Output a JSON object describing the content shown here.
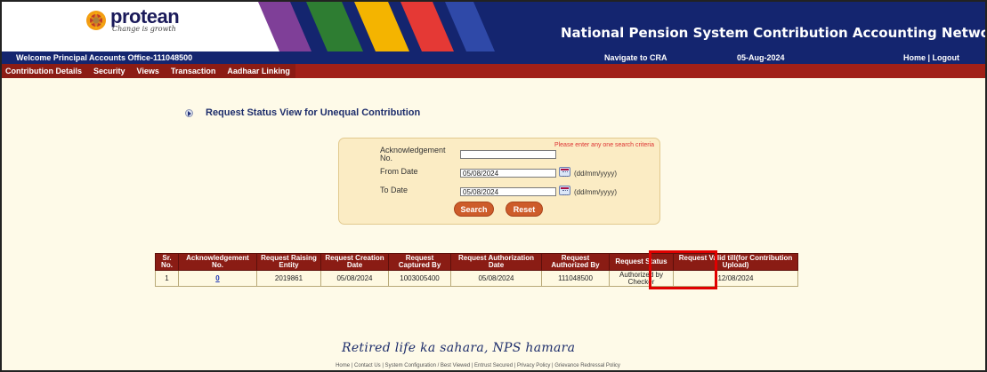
{
  "brand": {
    "name": "protean",
    "tagline": "Change is growth"
  },
  "header": {
    "site_title": "National Pension System Contribution Accounting Network",
    "welcome": "Welcome Principal Accounts Office-111048500",
    "navigate": "Navigate to CRA",
    "date": "05-Aug-2024",
    "links": "Home | Logout"
  },
  "menu": [
    "Contribution Details",
    "Security",
    "Views",
    "Transaction",
    "Aadhaar Linking"
  ],
  "page": {
    "heading": "Request Status View for Unequal Contribution"
  },
  "search": {
    "hint": "Please enter any one search criteria",
    "ack_label": "Acknowledgement No.",
    "ack_value": "",
    "from_label": "From Date",
    "from_value": "05/08/2024",
    "to_label": "To Date",
    "to_value": "05/08/2024",
    "date_format": "(dd/mm/yyyy)",
    "search_button": "Search",
    "reset_button": "Reset"
  },
  "table": {
    "headers": [
      "Sr. No.",
      "Acknowledgement No.",
      "Request Raising Entity",
      "Request Creation Date",
      "Request Captured By",
      "Request Authorization Date",
      "Request Authorized By",
      "Request Status",
      "Request Valid till(for Contribution Upload)"
    ],
    "rows": [
      [
        "1",
        "0",
        "2019861",
        "05/08/2024",
        "1003005400",
        "05/08/2024",
        "111048500",
        "Authorized by Checker",
        "12/08/2024"
      ]
    ]
  },
  "footer": {
    "slogan": "Retired life ka sahara, NPS hamara",
    "links": "Home | Contact Us | System Configuration / Best Viewed | Entrust Secured | Privacy Policy | Grievance Redressal Policy"
  },
  "colors": {
    "header_blue": "#14256f",
    "menu_red": "#a12018",
    "content_bg": "#fefae8",
    "table_header": "#8a1c14",
    "highlight": "#e00000"
  }
}
